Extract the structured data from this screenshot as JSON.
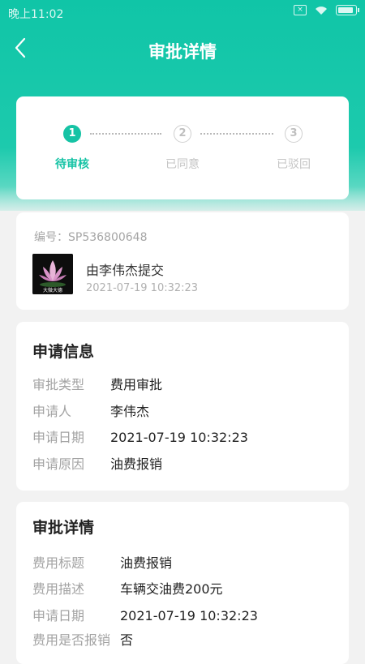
{
  "status_bar": {
    "time": "晚上11:02",
    "sim_label": "×"
  },
  "nav": {
    "title": "审批详情"
  },
  "steps": [
    {
      "number": "1",
      "label": "待审核",
      "state": "active"
    },
    {
      "number": "2",
      "label": "已同意",
      "state": "inactive"
    },
    {
      "number": "3",
      "label": "已驳回",
      "state": "inactive"
    }
  ],
  "submission": {
    "serial": "编号：SP536800648",
    "avatar_text": "大微大德",
    "submitter": "由李伟杰提交",
    "time": "2021-07-19 10:32:23"
  },
  "application_info": {
    "heading": "申请信息",
    "rows": [
      {
        "label": "审批类型",
        "value": "费用审批"
      },
      {
        "label": "申请人",
        "value": "李伟杰"
      },
      {
        "label": "申请日期",
        "value": "2021-07-19 10:32:23"
      },
      {
        "label": "申请原因",
        "value": "油费报销"
      }
    ]
  },
  "approval_detail": {
    "heading": "审批详情",
    "rows": [
      {
        "label": "费用标题",
        "value": "油费报销"
      },
      {
        "label": "费用描述",
        "value": "车辆交油费200元"
      },
      {
        "label": "申请日期",
        "value": "2021-07-19 10:32:23"
      },
      {
        "label": "费用是否报销",
        "value": "否"
      }
    ]
  },
  "colors": {
    "accent": "#16c3a5",
    "header_gradient_top": "#10c5a7"
  }
}
